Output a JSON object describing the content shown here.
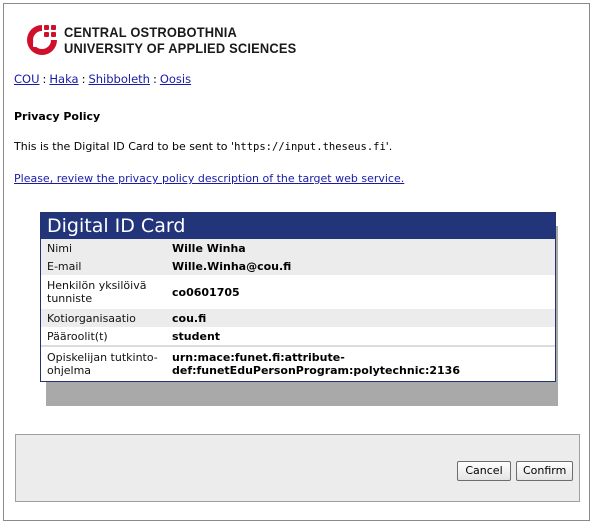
{
  "brand": {
    "line1": "CENTRAL OSTROBOTHNIA",
    "line2": "UNIVERSITY OF APPLIED SCIENCES",
    "logo_color": "#d0102b"
  },
  "nav": {
    "items": [
      "COU",
      "Haka",
      "Shibboleth",
      "Oosis"
    ],
    "separator": ":"
  },
  "page": {
    "heading": "Privacy Policy",
    "intro_prefix": "This is the Digital ID Card to be sent to '",
    "intro_url": "https://input.theseus.fi",
    "intro_suffix": "'.",
    "policy_link": "Please, review the privacy policy description of the target web service."
  },
  "card": {
    "title": "Digital ID Card",
    "header_color": "#22357a",
    "rows": [
      {
        "label": "Nimi",
        "value": "Wille Winha"
      },
      {
        "label": "E-mail",
        "value": "Wille.Winha@cou.fi"
      },
      {
        "label": "Henkilön yksilöivä tunniste",
        "value": "co0601705"
      },
      {
        "label": "Kotiorganisaatio",
        "value": "cou.fi"
      },
      {
        "label": "Pääroolit(t)",
        "value": "student"
      },
      {
        "label": "Opiskelijan tutkinto-ohjelma",
        "value": "urn:mace:funet.fi:attribute-def:funetEduPersonProgram:polytechnic:2136"
      }
    ]
  },
  "actions": {
    "cancel": "Cancel",
    "confirm": "Confirm"
  }
}
